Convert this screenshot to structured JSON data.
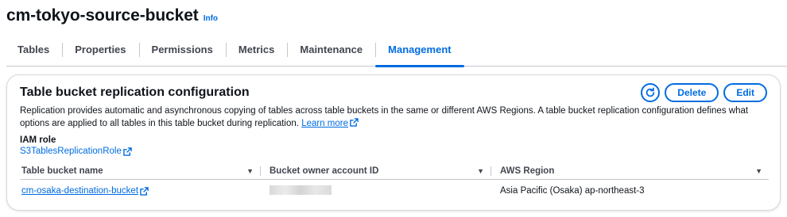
{
  "header": {
    "title": "cm-tokyo-source-bucket",
    "info": "Info"
  },
  "tabs": [
    {
      "label": "Tables",
      "active": false
    },
    {
      "label": "Properties",
      "active": false
    },
    {
      "label": "Permissions",
      "active": false
    },
    {
      "label": "Metrics",
      "active": false
    },
    {
      "label": "Maintenance",
      "active": false
    },
    {
      "label": "Management",
      "active": true
    }
  ],
  "panel": {
    "title": "Table bucket replication configuration",
    "refresh_icon": "refresh-icon",
    "delete_label": "Delete",
    "edit_label": "Edit",
    "description": "Replication provides automatic and asynchronous copying of tables across table buckets in the same or different AWS Regions. A table bucket replication configuration defines what options are applied to all tables in this table bucket during replication.",
    "learn_more": "Learn more",
    "iam_label": "IAM role",
    "iam_value": "S3TablesReplicationRole",
    "columns": [
      "Table bucket name",
      "Bucket owner account ID",
      "AWS Region"
    ],
    "rows": [
      {
        "bucket": "cm-osaka-destination-bucket",
        "account_id": "",
        "region": "Asia Pacific (Osaka) ap-northeast-3"
      }
    ]
  },
  "colors": {
    "accent": "#006ce0",
    "text": "#0f141a",
    "muted": "#424650",
    "border": "#c6c6cd"
  }
}
